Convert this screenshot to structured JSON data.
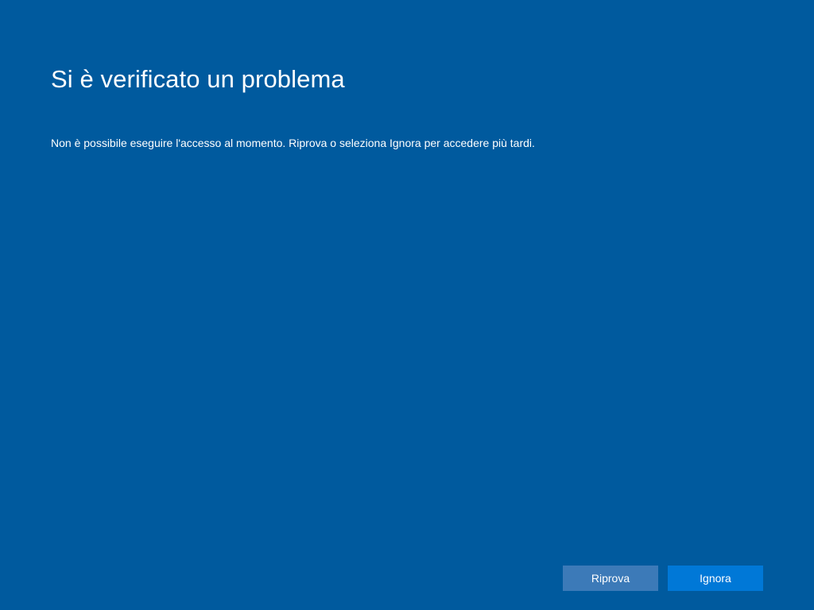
{
  "dialog": {
    "title": "Si è verificato un problema",
    "message": "Non è possibile eseguire l'accesso al momento. Riprova o seleziona Ignora per accedere più tardi."
  },
  "buttons": {
    "retry_label": "Riprova",
    "skip_label": "Ignora"
  },
  "colors": {
    "background": "#005a9e",
    "secondary_button": "#3c7ab8",
    "primary_button": "#0078d7",
    "text": "#ffffff"
  }
}
